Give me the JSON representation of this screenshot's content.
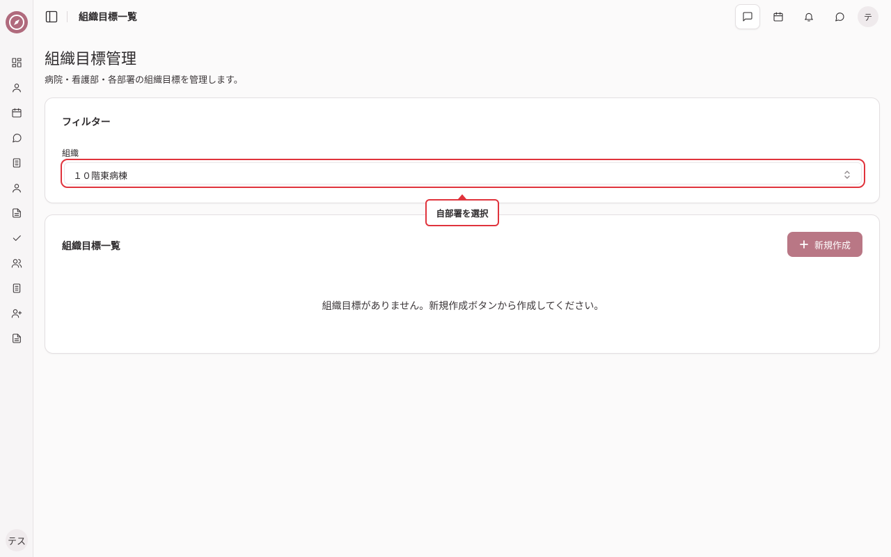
{
  "header": {
    "title": "組織目標一覧",
    "avatar_text": "テ"
  },
  "sidebar": {
    "items": [
      {
        "icon": "dashboard-icon"
      },
      {
        "icon": "user-icon"
      },
      {
        "icon": "calendar-icon"
      },
      {
        "icon": "chat-icon"
      },
      {
        "icon": "document-icon"
      },
      {
        "icon": "user-icon"
      },
      {
        "icon": "file-text-icon"
      },
      {
        "icon": "check-icon"
      },
      {
        "icon": "users-icon"
      },
      {
        "icon": "book-icon"
      },
      {
        "icon": "user-plus-icon"
      },
      {
        "icon": "file-text-icon"
      }
    ],
    "avatar_text": "テス"
  },
  "page": {
    "title": "組織目標管理",
    "subtitle": "病院・看護部・各部署の組織目標を管理します。"
  },
  "filter": {
    "title": "フィルター",
    "label": "組織",
    "selected": "１０階東病棟",
    "tooltip": "自部署を選択"
  },
  "list": {
    "title": "組織目標一覧",
    "new_button": "新規作成",
    "empty_message": "組織目標がありません。新規作成ボタンから作成してください。"
  },
  "colors": {
    "accent": "#b97785",
    "highlight": "#e0333c"
  }
}
